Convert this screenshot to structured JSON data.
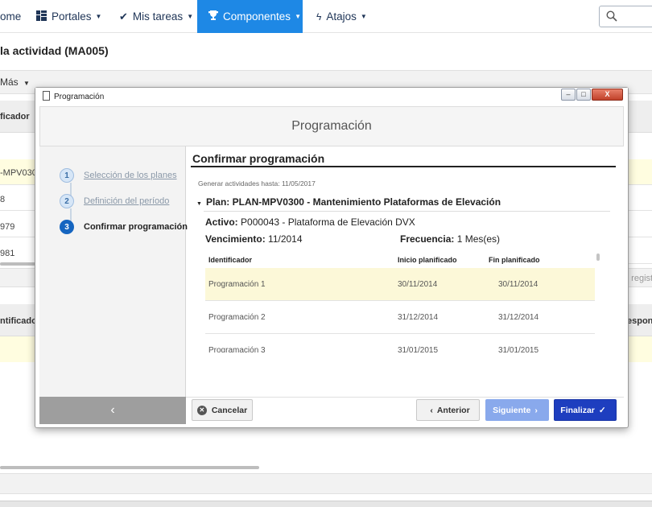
{
  "navbar": {
    "home_label": "ome",
    "portales_label": "Portales",
    "tareas_label": "Mis tareas",
    "componentes_label": "Componentes",
    "atajos_label": "Atajos",
    "active_color": "#1e88e5"
  },
  "page": {
    "title": "la actividad (MA005)",
    "more_label": "Más",
    "header1_label": "ficador",
    "rows": [
      "-MPV030",
      "8",
      "979",
      "981"
    ],
    "records_label": "e regist",
    "header2_label": "ntificador",
    "header2_right": "espons"
  },
  "window": {
    "title": "Programación",
    "btn_minimize": "–",
    "btn_maximize": "□",
    "btn_close": "X"
  },
  "dialog": {
    "title": "Programación",
    "steps": [
      {
        "num": "1",
        "label": "Selección de los planes",
        "state": "done"
      },
      {
        "num": "2",
        "label": "Definición del período",
        "state": "done"
      },
      {
        "num": "3",
        "label": "Confirmar programación",
        "state": "active"
      }
    ],
    "back_label": "‹",
    "content_title": "Confirmar programación",
    "generate_until": "Generar actividades hasta: 11/05/2017",
    "plan": "Plan: PLAN-MPV0300 - Mantenimiento Plataformas de Elevación",
    "activo_label": "Activo:",
    "activo_value": "P000043 - Plataforma de Elevación DVX",
    "venc_label": "Vencimiento:",
    "venc_value": "11/2014",
    "freq_label": "Frecuencia:",
    "freq_value": "1 Mes(es)",
    "table": {
      "headers": [
        "Identificador",
        "Inicio planificado",
        "Fin planificado"
      ],
      "rows": [
        [
          "Programación 1",
          "30/11/2014",
          "30/11/2014"
        ],
        [
          "Programación 2",
          "31/12/2014",
          "31/12/2014"
        ],
        [
          "Programación 3",
          "31/01/2015",
          "31/01/2015"
        ]
      ]
    },
    "buttons": {
      "cancel": "Cancelar",
      "prev": "Anterior",
      "next": "Siguiente",
      "finish": "Finalizar"
    }
  }
}
